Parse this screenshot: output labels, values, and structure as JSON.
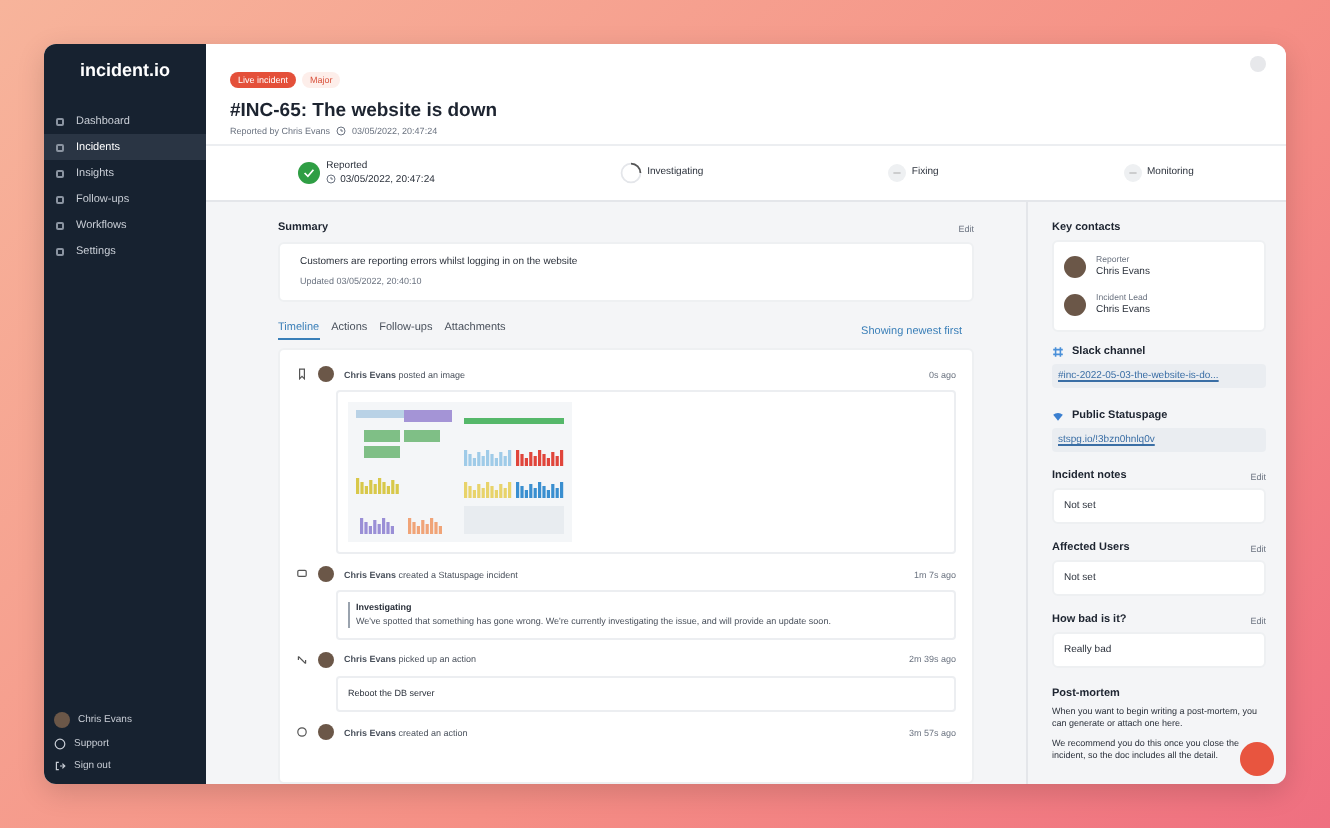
{
  "brand": "incident.io",
  "nav": [
    {
      "label": "Dashboard",
      "selected": false
    },
    {
      "label": "Incidents",
      "selected": true
    },
    {
      "label": "Insights",
      "selected": false
    },
    {
      "label": "Follow-ups",
      "selected": false
    },
    {
      "label": "Workflows",
      "selected": false
    },
    {
      "label": "Settings",
      "selected": false
    }
  ],
  "user": "Chris Evans",
  "footer_links": [
    {
      "kind": "support",
      "label": "Support"
    },
    {
      "kind": "signout",
      "label": "Sign out"
    }
  ],
  "badges": [
    {
      "kind": "live",
      "label": "Live incident"
    },
    {
      "kind": "severity",
      "label": "Major"
    }
  ],
  "title": "#INC-65: The website is down",
  "reported_by": "Reported by Chris Evans",
  "reported_time": "03/05/2022, 20:47:24",
  "stages": [
    {
      "label": "Reported",
      "time": "03/05/2022, 20:47:24",
      "done": true,
      "active": false
    },
    {
      "label": "Investigating",
      "done": false,
      "active": true
    },
    {
      "label": "Fixing",
      "done": false,
      "active": false
    },
    {
      "label": "Monitoring",
      "done": false,
      "active": false
    }
  ],
  "summary": {
    "heading": "Summary",
    "edit": "Edit",
    "text": "Customers are reporting errors whilst logging in on the website",
    "updated": "Updated 03/05/2022, 20:40:10"
  },
  "tabs": [
    {
      "label": "Timeline",
      "selected": true
    },
    {
      "label": "Actions",
      "selected": false
    },
    {
      "label": "Follow-ups",
      "selected": false
    },
    {
      "label": "Attachments",
      "selected": false
    }
  ],
  "sort_label": "Showing newest first",
  "timeline": [
    {
      "kind": "image",
      "author": "Chris Evans",
      "action": "posted an image",
      "time": "0s ago"
    },
    {
      "kind": "statuspage",
      "author": "Chris Evans",
      "action": "created a Statuspage incident",
      "time": "1m 7s ago",
      "status": "Investigating",
      "message": "We've spotted that something has gone wrong. We're currently investigating the issue, and will provide an update soon."
    },
    {
      "kind": "action",
      "author": "Chris Evans",
      "action": "picked up an action",
      "time": "2m 39s ago",
      "message": "Reboot the DB server"
    },
    {
      "kind": "created",
      "author": "Chris Evans",
      "action": "created an action",
      "time": "3m 57s ago"
    }
  ],
  "key_contacts": {
    "heading": "Key contacts",
    "contacts": [
      {
        "role": "Reporter",
        "name": "Chris Evans"
      },
      {
        "role": "Incident Lead",
        "name": "Chris Evans"
      }
    ]
  },
  "links": [
    {
      "kind": "slack",
      "heading": "Slack channel",
      "value": "#inc-2022-05-03-the-website-is-do..."
    },
    {
      "kind": "statuspage",
      "heading": "Public Statuspage",
      "value": "stspg.io/!3bzn0hnlq0v"
    }
  ],
  "fields": [
    {
      "label": "Incident notes",
      "edit": "Edit",
      "value": "Not set"
    },
    {
      "label": "Affected Users",
      "edit": "Edit",
      "value": "Not set"
    },
    {
      "label": "How bad is it?",
      "edit": "Edit",
      "value": "Really bad"
    }
  ],
  "post_mortem": {
    "heading": "Post-mortem",
    "paragraphs": [
      "When you want to begin writing a post-mortem, you can generate or attach one here.",
      "We recommend you do this once you close the incident, so the doc includes all the detail."
    ]
  }
}
